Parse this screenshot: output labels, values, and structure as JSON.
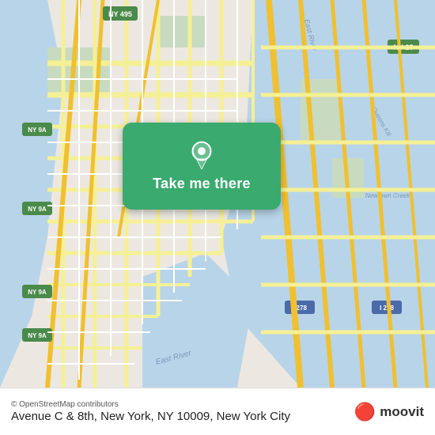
{
  "map": {
    "background_color": "#e8e0d8",
    "water_color": "#b8d4e8",
    "road_color_major": "#f5f5a0",
    "road_color_minor": "#ffffff",
    "green_area_color": "#c8dba0",
    "highway_color": "#f0c850"
  },
  "button": {
    "label": "Take me there",
    "background_color": "#3aaa6e",
    "pin_color": "#ffffff"
  },
  "bottom_bar": {
    "osm_credit": "© OpenStreetMap contributors",
    "location_text": "Avenue C & 8th, New York, NY 10009, New York City",
    "moovit_label": "moovit",
    "moovit_icon": "🔴"
  }
}
